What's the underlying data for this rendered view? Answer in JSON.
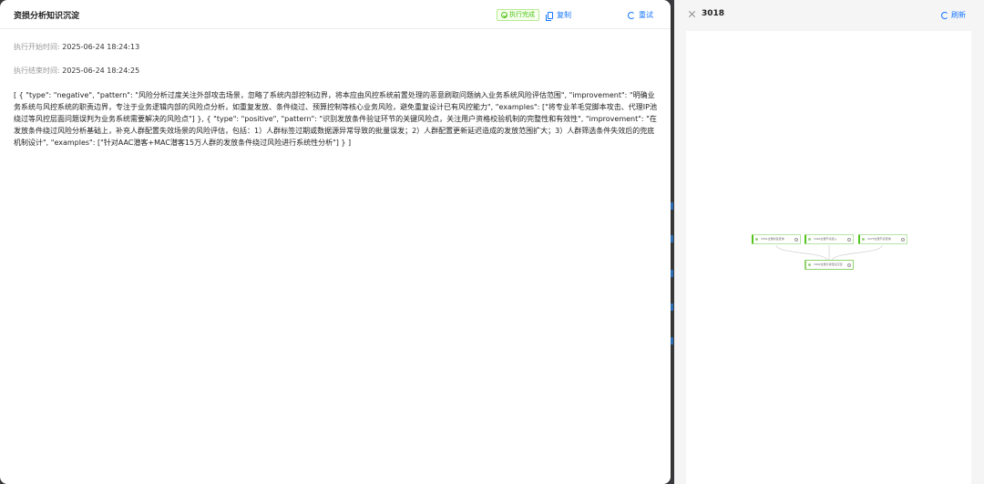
{
  "left": {
    "title": "资损分析知识沉淀",
    "status_badge": "执行完成",
    "copy_label": "复制",
    "retry_label": "重试",
    "start_label": "执行开始时间:",
    "start_value": "2025-06-24 18:24:13",
    "end_label": "执行结束时间:",
    "end_value": "2025-06-24 18:24:25",
    "result": "[ { \"type\": \"negative\", \"pattern\": \"风险分析过度关注外部攻击场景，忽略了系统内部控制边界，将本应由风控系统前置处理的恶意刷取问题纳入业务系统风险评估范围\", \"improvement\": \"明确业务系统与风控系统的职责边界，专注于业务逻辑内部的风险点分析，如重复发放、条件绕过、预算控制等核心业务风险，避免重复设计已有风控能力\", \"examples\": [\"将专业羊毛党脚本攻击、代理IP池绕过等风控层面问题误判为业务系统需要解决的风险点\"] }, { \"type\": \"positive\", \"pattern\": \"识别发放条件验证环节的关键风险点，关注用户资格校验机制的完整性和有效性\", \"improvement\": \"在发放条件绕过风险分析基础上，补充人群配置失效场景的风险评估，包括：1）人群标签过期或数据源异常导致的批量误发；2）人群配置更新延迟造成的发放范围扩大；3）人群筛选条件失效后的兜底机制设计\", \"examples\": [\"针对AAC潜客+MAC潜客15万人群的发放条件绕过风险进行系统性分析\"] } ]"
  },
  "right": {
    "title": "3018",
    "refresh_label": "刷新",
    "nodes": [
      {
        "label": "3451全量标签查询"
      },
      {
        "label": "3462全量节点接入"
      },
      {
        "label": "3475全量节点查询"
      },
      {
        "label": "3462全量分析结论沉淀"
      }
    ]
  },
  "colors": {
    "accent": "#1677ff",
    "success": "#52c41a"
  }
}
